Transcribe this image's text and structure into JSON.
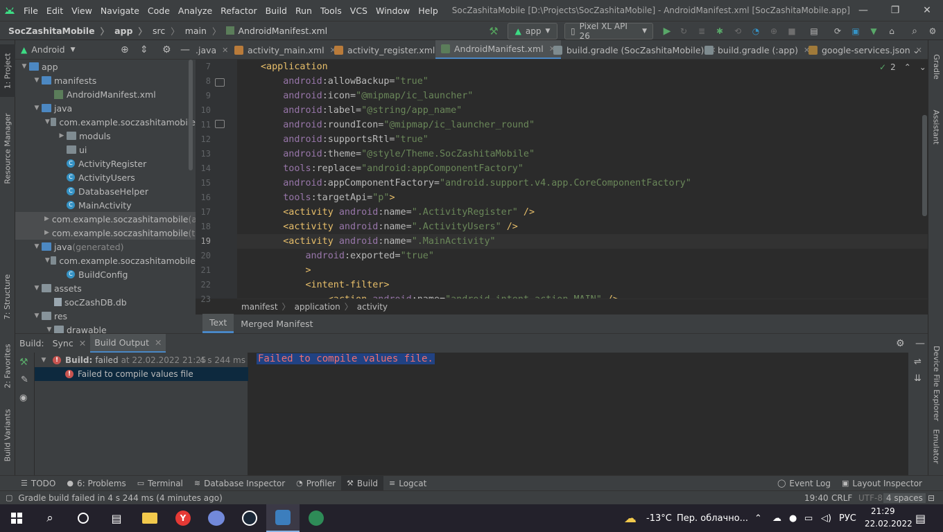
{
  "menubar": {
    "items": [
      "File",
      "Edit",
      "View",
      "Navigate",
      "Code",
      "Analyze",
      "Refactor",
      "Build",
      "Run",
      "Tools",
      "VCS",
      "Window",
      "Help"
    ],
    "window_title": "SocZashitaMobile [D:\\Projects\\SocZashitaMobile] - AndroidManifest.xml [SocZashitaMobile.app]"
  },
  "navbar": {
    "breadcrumbs": [
      "SocZashitaMobile",
      "app",
      "src",
      "main",
      "AndroidManifest.xml"
    ],
    "run_config": "app",
    "device": "Pixel XL API 26"
  },
  "project": {
    "view_mode": "Android",
    "tree": [
      {
        "label": "app",
        "depth": 0,
        "arrow": "down",
        "icon": "folder-blue"
      },
      {
        "label": "manifests",
        "depth": 1,
        "arrow": "down",
        "icon": "folder-blue"
      },
      {
        "label": "AndroidManifest.xml",
        "depth": 2,
        "arrow": "",
        "icon": "xml"
      },
      {
        "label": "java",
        "depth": 1,
        "arrow": "down",
        "icon": "folder-blue"
      },
      {
        "label": "com.example.soczashitamobile",
        "depth": 2,
        "arrow": "down",
        "icon": "package"
      },
      {
        "label": "moduls",
        "depth": 3,
        "arrow": "right",
        "icon": "package"
      },
      {
        "label": "ui",
        "depth": 3,
        "arrow": "",
        "icon": "package"
      },
      {
        "label": "ActivityRegister",
        "depth": 3,
        "arrow": "",
        "icon": "class"
      },
      {
        "label": "ActivityUsers",
        "depth": 3,
        "arrow": "",
        "icon": "class"
      },
      {
        "label": "DatabaseHelper",
        "depth": 3,
        "arrow": "",
        "icon": "class"
      },
      {
        "label": "MainActivity",
        "depth": 3,
        "arrow": "",
        "icon": "class"
      },
      {
        "label": "com.example.soczashitamobile",
        "suffix": "(a",
        "depth": 2,
        "arrow": "right",
        "icon": "package",
        "selected": true
      },
      {
        "label": "com.example.soczashitamobile",
        "suffix": "(te",
        "depth": 2,
        "arrow": "right",
        "icon": "package",
        "selected": true
      },
      {
        "label": "java",
        "suffix": "(generated)",
        "depth": 1,
        "arrow": "down",
        "icon": "folder-blue"
      },
      {
        "label": "com.example.soczashitamobile",
        "depth": 2,
        "arrow": "down",
        "icon": "package"
      },
      {
        "label": "BuildConfig",
        "depth": 3,
        "arrow": "",
        "icon": "class"
      },
      {
        "label": "assets",
        "depth": 1,
        "arrow": "down",
        "icon": "folder"
      },
      {
        "label": "socZashDB.db",
        "depth": 2,
        "arrow": "",
        "icon": "file"
      },
      {
        "label": "res",
        "depth": 1,
        "arrow": "down",
        "icon": "folder"
      },
      {
        "label": "drawable",
        "depth": 2,
        "arrow": "down",
        "icon": "folder"
      }
    ]
  },
  "left_strip": {
    "project": "1: Project",
    "resource_manager": "Resource Manager",
    "structure": "7: Structure",
    "favorites": "2: Favorites",
    "build_variants": "Build Variants"
  },
  "right_strip": {
    "gradle": "Gradle",
    "assistant": "Assistant",
    "device_file_explorer": "Device File Explorer",
    "emulator": "Emulator"
  },
  "editor_tabs": [
    ".java",
    "activity_main.xml",
    "activity_register.xml",
    "AndroidManifest.xml",
    "build.gradle (SocZashitaMobile)",
    "build.gradle (:app)",
    "google-services.json"
  ],
  "editor": {
    "inspection_count": "2",
    "line_numbers": [
      "7",
      "8",
      "9",
      "10",
      "11",
      "12",
      "13",
      "14",
      "15",
      "16",
      "17",
      "18",
      "19",
      "20",
      "21",
      "22",
      "23"
    ],
    "lines": [
      [
        {
          "t": "<application",
          "c": "tag"
        }
      ],
      [
        {
          "t": "    android",
          "c": "ns"
        },
        {
          "t": ":allowBackup=",
          "c": "attr"
        },
        {
          "t": "\"true\"",
          "c": "val"
        }
      ],
      [
        {
          "t": "    android",
          "c": "ns"
        },
        {
          "t": ":icon=",
          "c": "attr"
        },
        {
          "t": "\"@mipmap/ic_launcher\"",
          "c": "val"
        }
      ],
      [
        {
          "t": "    android",
          "c": "ns"
        },
        {
          "t": ":label=",
          "c": "attr"
        },
        {
          "t": "\"@string/app_name\"",
          "c": "val"
        }
      ],
      [
        {
          "t": "    android",
          "c": "ns"
        },
        {
          "t": ":roundIcon=",
          "c": "attr"
        },
        {
          "t": "\"@mipmap/ic_launcher_round\"",
          "c": "val"
        }
      ],
      [
        {
          "t": "    android",
          "c": "ns"
        },
        {
          "t": ":supportsRtl=",
          "c": "attr"
        },
        {
          "t": "\"true\"",
          "c": "val"
        }
      ],
      [
        {
          "t": "    android",
          "c": "ns"
        },
        {
          "t": ":theme=",
          "c": "attr"
        },
        {
          "t": "\"@style/Theme.SocZashitaMobile\"",
          "c": "val"
        }
      ],
      [
        {
          "t": "    tools",
          "c": "ns"
        },
        {
          "t": ":replace=",
          "c": "attr"
        },
        {
          "t": "\"android:appComponentFactory\"",
          "c": "val"
        }
      ],
      [
        {
          "t": "    android",
          "c": "ns"
        },
        {
          "t": ":appComponentFactory=",
          "c": "attr"
        },
        {
          "t": "\"android.support.v4.app.CoreComponentFactory\"",
          "c": "val"
        }
      ],
      [
        {
          "t": "    tools",
          "c": "ns"
        },
        {
          "t": ":targetApi=",
          "c": "attr"
        },
        {
          "t": "\"p\"",
          "c": "val"
        },
        {
          "t": ">",
          "c": "tag"
        }
      ],
      [
        {
          "t": "    <activity ",
          "c": "tag"
        },
        {
          "t": "android",
          "c": "ns"
        },
        {
          "t": ":name=",
          "c": "attr"
        },
        {
          "t": "\".ActivityRegister\"",
          "c": "val"
        },
        {
          "t": " />",
          "c": "tag"
        }
      ],
      [
        {
          "t": "    <activity ",
          "c": "tag"
        },
        {
          "t": "android",
          "c": "ns"
        },
        {
          "t": ":name=",
          "c": "attr"
        },
        {
          "t": "\".ActivityUsers\"",
          "c": "val"
        },
        {
          "t": " />",
          "c": "tag"
        }
      ],
      [
        {
          "t": "    <activity ",
          "c": "tag"
        },
        {
          "t": "android",
          "c": "ns"
        },
        {
          "t": ":name=",
          "c": "attr"
        },
        {
          "t": "\".MainActivity\"",
          "c": "val"
        }
      ],
      [
        {
          "t": "        android",
          "c": "ns"
        },
        {
          "t": ":exported=",
          "c": "attr"
        },
        {
          "t": "\"true\"",
          "c": "val"
        }
      ],
      [
        {
          "t": "        >",
          "c": "tag"
        }
      ],
      [
        {
          "t": "        <intent-filter>",
          "c": "tag"
        }
      ],
      [
        {
          "t": "            <action ",
          "c": "tag"
        },
        {
          "t": "android",
          "c": "ns"
        },
        {
          "t": ":name=",
          "c": "attr"
        },
        {
          "t": "\"android.intent.action.MAIN\"",
          "c": "val"
        },
        {
          "t": " />",
          "c": "tag"
        }
      ]
    ],
    "breadcrumbs": [
      "manifest",
      "application",
      "activity"
    ]
  },
  "subtabs": [
    "Text",
    "Merged Manifest"
  ],
  "build": {
    "header_label": "Build:",
    "tabs": [
      "Sync",
      "Build Output"
    ],
    "tree_root_bold": "Build:",
    "tree_root_status": "failed",
    "tree_root_time": "at 22.02.2022 21:25",
    "tree_root_duration": "4 s 244 ms",
    "tree_child": "Failed to compile values file",
    "output_message": "Failed to compile values file."
  },
  "toolwindows": {
    "left": [
      {
        "icon": "☰",
        "label": "TODO"
      },
      {
        "icon": "●",
        "label": "6: Problems"
      },
      {
        "icon": "▭",
        "label": "Terminal"
      },
      {
        "icon": "≋",
        "label": "Database Inspector"
      },
      {
        "icon": "◔",
        "label": "Profiler"
      },
      {
        "icon": "⚒",
        "label": "Build"
      },
      {
        "icon": "≡",
        "label": "Logcat"
      }
    ],
    "right": [
      {
        "icon": "◯",
        "label": "Event Log"
      },
      {
        "icon": "▣",
        "label": "Layout Inspector"
      }
    ]
  },
  "statusbar": {
    "message": "Gradle build failed in 4 s 244 ms (4 minutes ago)",
    "position": "19:40",
    "line_sep": "CRLF",
    "encoding": "UTF-8",
    "indent": "4 spaces"
  },
  "taskbar": {
    "weather_temp": "-13°C",
    "weather_text": "Пер. облачно...",
    "lang": "РУС",
    "time": "21:29",
    "date": "22.02.2022"
  },
  "colors": {
    "accent": "#4a88c7",
    "error": "#c75450",
    "highlight_bg": "#214283"
  }
}
